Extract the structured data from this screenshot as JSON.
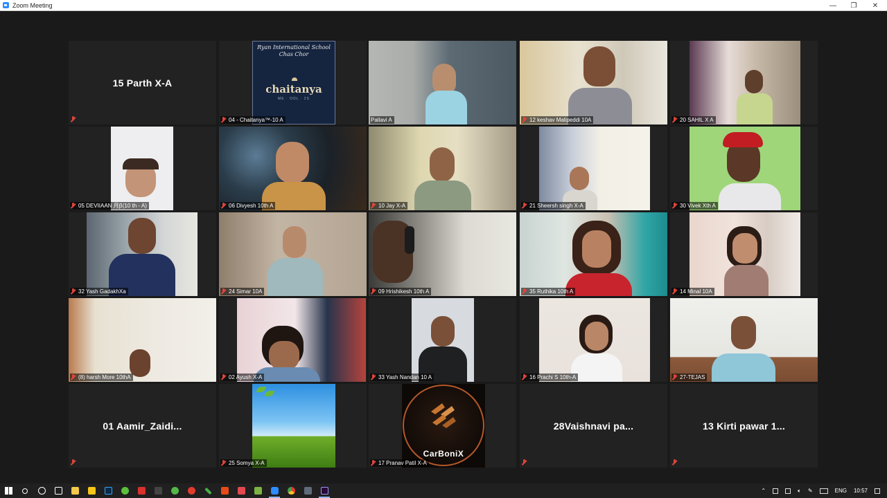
{
  "window": {
    "title": "Zoom Meeting",
    "controls": [
      "—",
      "❐",
      "✕"
    ]
  },
  "participants": [
    {
      "name": "15 Parth X-A",
      "display": "name"
    },
    {
      "name": "04 - Chaitanya™-10 A",
      "display": "logo",
      "logo_school": "Ryan International School Chas Chor",
      "logo_brand": "chaitanya",
      "logo_sub": "ME · OOL · 2S"
    },
    {
      "name": "Pallavi A",
      "display": "video",
      "active_speaker": true
    },
    {
      "name": "12 keshav Malipeddi 10A",
      "display": "video"
    },
    {
      "name": "20 SAHIL X A",
      "display": "video"
    },
    {
      "name": "05  DEVIIAAN 月ꞵ(10 th - A)",
      "display": "video"
    },
    {
      "name": "06 Divyesh 10th A",
      "display": "video"
    },
    {
      "name": "10 Jay X-A",
      "display": "video"
    },
    {
      "name": "21 Sheersh singh X-A",
      "display": "video"
    },
    {
      "name": "30 Vivek Xth A",
      "display": "video"
    },
    {
      "name": "32 Yash GadakhXa",
      "display": "video"
    },
    {
      "name": "24 Simar 10A",
      "display": "video"
    },
    {
      "name": "09 Hrishikesh 10th A",
      "display": "video"
    },
    {
      "name": "35 Ruthika 10th A",
      "display": "video"
    },
    {
      "name": "14 Minal 10A",
      "display": "video"
    },
    {
      "name": "(8) harsh More 10thA",
      "display": "video"
    },
    {
      "name": "02 Ayush X-A",
      "display": "video"
    },
    {
      "name": "33 Yash Nandan 10 A",
      "display": "video"
    },
    {
      "name": "16 Prachi S 10th-A",
      "display": "video"
    },
    {
      "name": "27-TEJAS",
      "display": "video"
    },
    {
      "name": "01  Aamir_Zaidi...",
      "display": "name"
    },
    {
      "name": "25 Somya X-A",
      "display": "picture"
    },
    {
      "name": "17 Pranav Patil X-A",
      "display": "logo2",
      "logo_label": "CarBoniX"
    },
    {
      "name": "28Vaishnavi  pa...",
      "display": "name"
    },
    {
      "name": "13 Kirti pawar 1...",
      "display": "name"
    }
  ],
  "taskbar": {
    "apps": [
      "windows-start",
      "search",
      "cortana",
      "task-view",
      "file-explorer",
      "photos",
      "photoshop",
      "cleaner",
      "adobe-reader",
      "media",
      "greenshot",
      "record",
      "pencil",
      "office",
      "adobe",
      "android-studio",
      "zoom",
      "chrome",
      "calculator",
      "premiere"
    ],
    "tray_language": "ENG",
    "tray_time": "10:57"
  },
  "colors": {
    "active_border": "#b4d14c",
    "stage_bg": "#1a1a1a",
    "tile_bg": "#222222",
    "muted_mic": "#e0453a"
  }
}
